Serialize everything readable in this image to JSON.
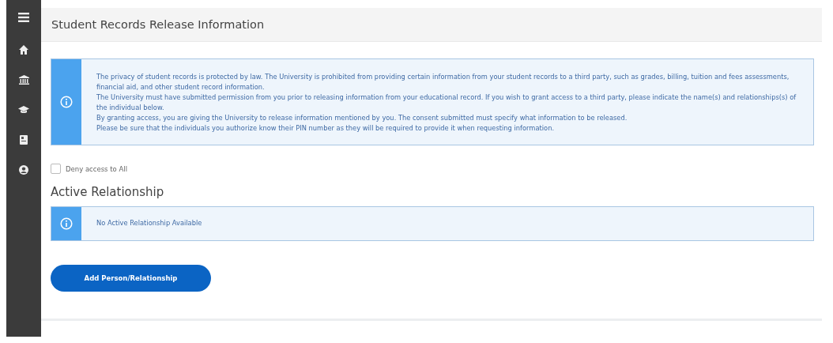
{
  "sidebar": {
    "items": [
      {
        "kind": "menu"
      },
      {
        "kind": "home"
      },
      {
        "kind": "bank"
      },
      {
        "kind": "cap"
      },
      {
        "kind": "document"
      },
      {
        "kind": "user"
      }
    ]
  },
  "header": {
    "title": "Student Records Release Information"
  },
  "notice": {
    "paragraphs": [
      "The privacy of student records is protected by law. The University is prohibited from providing certain information from your student records to a third party, such as grades, billing, tuition and fees assessments, financial aid, and other student record information.",
      "The University must have submitted permission from you prior to releasing information from your educational record. If you wish to grant access to a third party, please indicate the name(s) and relationships(s) of the individual below.",
      "By granting access, you are giving the University to release information mentioned by you. The consent submitted must specify what information to be released.",
      "Please be sure that the individuals you authorize know their PIN number as they will be required to provide it when requesting information."
    ]
  },
  "deny_access": {
    "label": "Deny access to All",
    "checked": false
  },
  "active_relationship": {
    "heading": "Active Relationship",
    "message": "No Active Relationship Available"
  },
  "add_button": {
    "label": "Add Person/Relationship"
  }
}
